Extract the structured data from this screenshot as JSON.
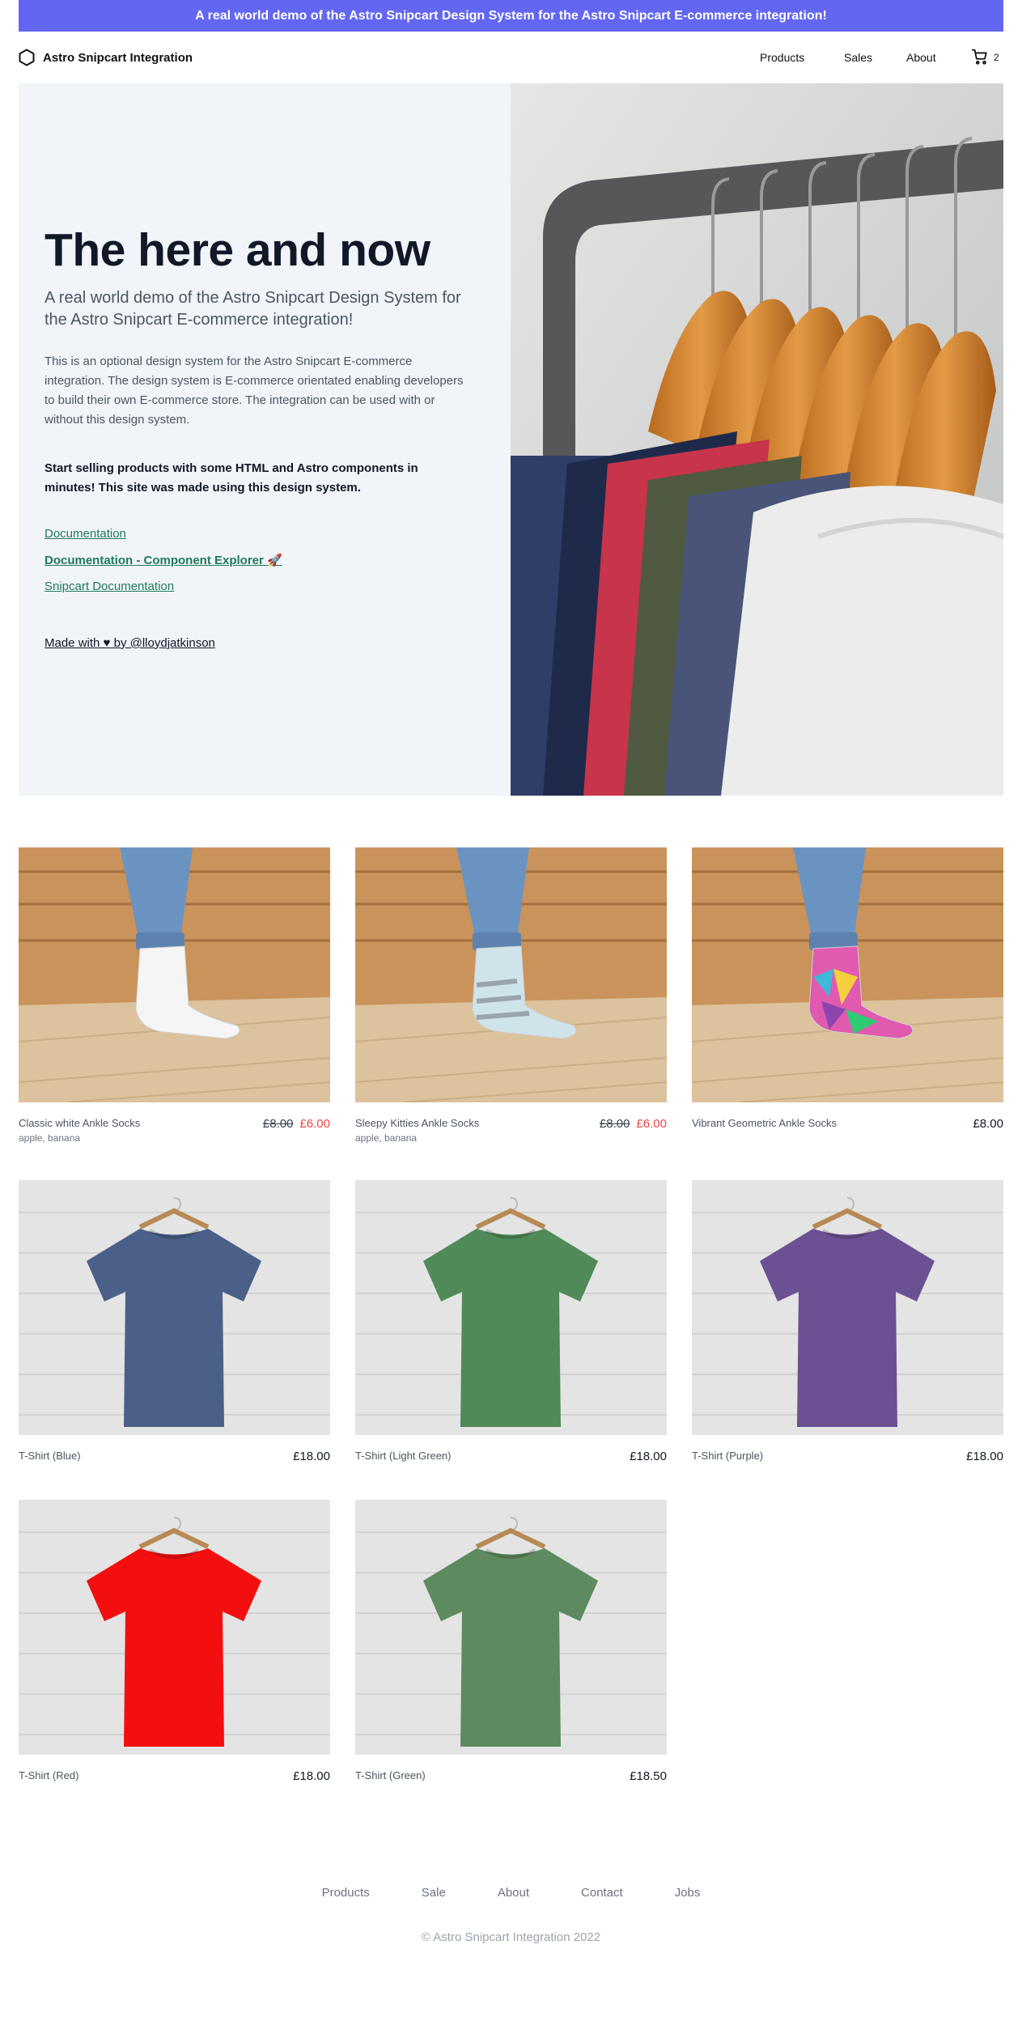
{
  "banner": {
    "text": "A real world demo of the Astro Snipcart Design System for the Astro Snipcart E-commerce integration!"
  },
  "nav": {
    "brand": "Astro Snipcart Integration",
    "brand_icon": "hexagon-icon",
    "links": [
      "Products",
      "Sales",
      "About"
    ],
    "cart_icon": "cart-icon",
    "cart_count": "2"
  },
  "hero": {
    "title": "The here and now",
    "subtitle": "A real world demo of the Astro Snipcart Design System for the Astro Snipcart E-commerce integration!",
    "description": "This is an optional design system for the Astro Snipcart E-commerce integration. The design system is E-commerce orientated enabling developers to build their own E-commerce store. The integration can be used with or without this design system.",
    "cta": "Start selling products with some HTML and Astro components in minutes! This site was made using this design system.",
    "links": [
      "Documentation",
      "Documentation - Component Explorer 🚀",
      "Snipcart Documentation"
    ],
    "made_with": "Made with ♥ by @lloydjatkinson"
  },
  "products": [
    {
      "name": "Classic white Ankle Socks",
      "tags": "apple, banana",
      "old_price": "£8.00",
      "price": "£6.00",
      "kind": "sock",
      "color": "#f5f5f5"
    },
    {
      "name": "Sleepy Kitties Ankle Socks",
      "tags": "apple, banana",
      "old_price": "£8.00",
      "price": "£6.00",
      "kind": "sock",
      "color": "#cfe3ea"
    },
    {
      "name": "Vibrant Geometric Ankle Socks",
      "tags": "",
      "old_price": "",
      "price": "£8.00",
      "kind": "sock",
      "color": "#e05ab0"
    },
    {
      "name": "T-Shirt (Blue)",
      "tags": "",
      "old_price": "",
      "price": "£18.00",
      "kind": "shirt",
      "color": "#4a6089"
    },
    {
      "name": "T-Shirt (Light Green)",
      "tags": "",
      "old_price": "",
      "price": "£18.00",
      "kind": "shirt",
      "color": "#4f8a58"
    },
    {
      "name": "T-Shirt (Purple)",
      "tags": "",
      "old_price": "",
      "price": "£18.00",
      "kind": "shirt",
      "color": "#6b5093"
    },
    {
      "name": "T-Shirt (Red)",
      "tags": "",
      "old_price": "",
      "price": "£18.00",
      "kind": "shirt",
      "color": "#f30f0f"
    },
    {
      "name": "T-Shirt (Green)",
      "tags": "",
      "old_price": "",
      "price": "£18.50",
      "kind": "shirt",
      "color": "#5d8a5f"
    }
  ],
  "footer": {
    "links": [
      "Products",
      "Sale",
      "About",
      "Contact",
      "Jobs"
    ],
    "copyright": "© Astro Snipcart Integration 2022"
  }
}
